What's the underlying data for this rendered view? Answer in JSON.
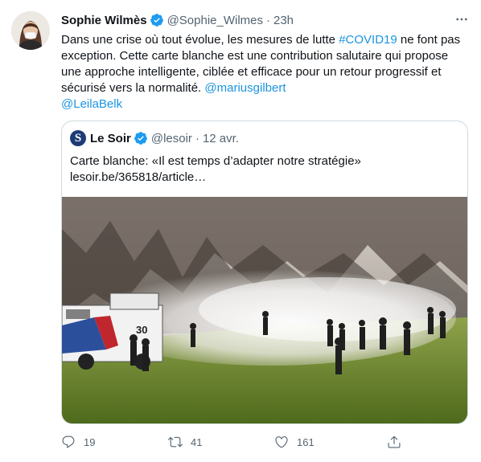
{
  "author": {
    "display_name": "Sophie Wilmès",
    "handle": "@Sophie_Wilmes",
    "separator": "·",
    "time": "23h"
  },
  "tweet": {
    "text_1": "Dans une crise où tout évolue, les mesures de lutte ",
    "hashtag": "#COVID19",
    "text_2": " ne font pas exception. Cette carte blanche est une contribution salutaire qui propose une approche intelligente, ciblée et efficace pour un retour progressif et sécurisé vers la normalité. ",
    "mention_1": "@mariusgilbert",
    "space": " ",
    "mention_2": "@LeilaBelk"
  },
  "quote": {
    "logo_letter": "S",
    "display_name": "Le Soir",
    "handle": "@lesoir",
    "separator": "·",
    "date": "12 avr.",
    "text_line_1": "Carte blanche: «Il est temps d’adapter notre stratégie»",
    "text_line_2": "lesoir.be/365818/article…",
    "image_truck_number": "30"
  },
  "actions": {
    "reply_count": "19",
    "retweet_count": "41",
    "like_count": "161"
  },
  "colors": {
    "link": "#1b95e0",
    "verified": "#1d9bf0",
    "secondary_text": "#536471",
    "border": "#cfd9de"
  }
}
